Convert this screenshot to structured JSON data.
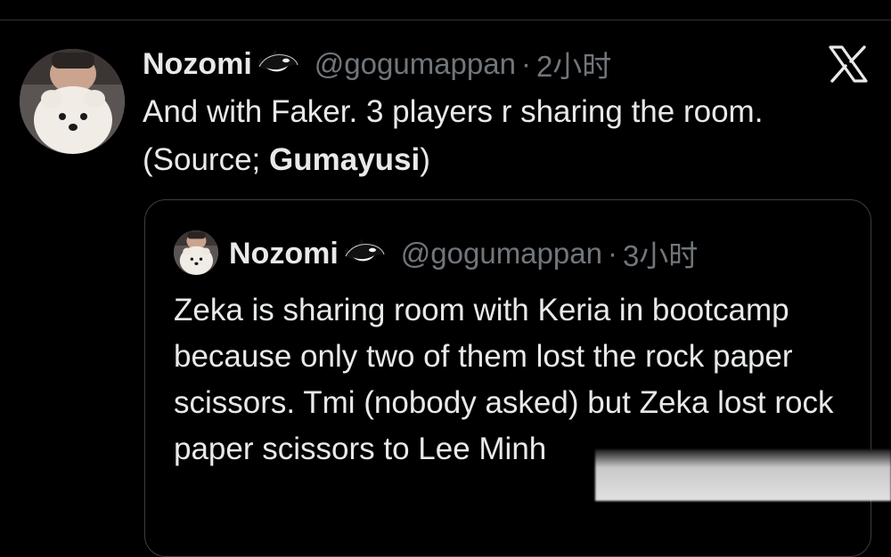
{
  "tweet": {
    "display_name": "Nozomi",
    "handle": "@gogumappan",
    "separator": "·",
    "time": "2小时",
    "text_line1": "And with Faker. 3 players r sharing the room.",
    "text_source_prefix": "(Source; ",
    "text_source_name": "Gumayusi",
    "text_source_suffix": ")"
  },
  "quoted_tweet": {
    "display_name": "Nozomi",
    "handle": "@gogumappan",
    "separator": "·",
    "time": "3小时",
    "text": "Zeka is sharing room with Keria in bootcamp because only two of them lost the rock paper scissors. Tmi (nobody asked) but Zeka lost rock paper scissors to Lee Minh"
  },
  "icons": {
    "x_logo": "x-logo-icon",
    "emoji": "orca-emoji-icon"
  },
  "colors": {
    "background": "#000000",
    "primary_text": "#e7e9ea",
    "secondary_text": "#71767b",
    "border": "#3a3f44"
  }
}
